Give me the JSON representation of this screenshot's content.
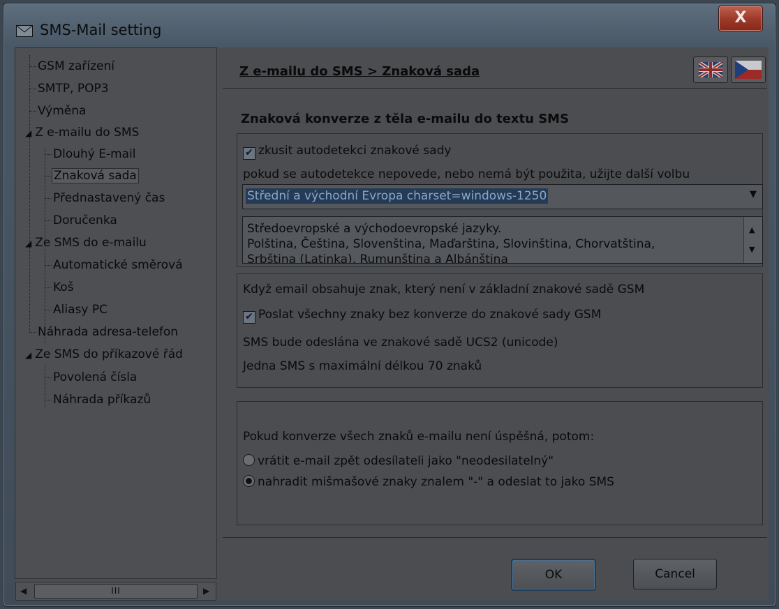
{
  "window": {
    "title": "SMS-Mail setting",
    "close_label": "X"
  },
  "tree": {
    "items": [
      "GSM zařízení",
      "SMTP, POP3",
      "Výměna",
      "Z e-mailu do SMS",
      "Dlouhý E-mail",
      "Znaková sada",
      "Přednastavený čas",
      "Doručenka",
      "Ze SMS do e-mailu",
      "Automatické směrová",
      "Koš",
      "Aliasy PC",
      "Náhrada adresa-telefon",
      "Ze SMS do příkazové řád",
      "Povolená čísla",
      "Náhrada příkazů"
    ],
    "selected": "Znaková sada",
    "scroll_thumb": "III"
  },
  "header": {
    "breadcrumb": "Z e-mailu do SMS  >  Znaková sada"
  },
  "section": {
    "title": "Znaková konverze z těla e-mailu do textu SMS"
  },
  "charset": {
    "autodetect_label": "zkusit autodetekci znakové sady",
    "autodetect_checked": true,
    "fallback_hint": "pokud se autodetekce nepovede, nebo nemá být použita, užijte další volbu",
    "selected_value": "Střední a východní Evropa  charset=windows-1250",
    "description_line1": "Středoevropské a východoevropské jazyky.",
    "description_line2": "Polština, Čeština, Slovenština, Maďarština, Slovinština, Chorvatština,",
    "description_line3": "Srbština (Latinka), Rumunština a Albánština"
  },
  "gsm": {
    "intro": "Když email obsahuje znak, který není v základní znakové sadě GSM",
    "send_all_label": "Poslat všechny znaky bez konverze do znakové sady GSM",
    "send_all_checked": true,
    "ucs2_note": "SMS bude odeslána ve znakové sadě UCS2 (unicode)",
    "length_note": "Jedna SMS s maximální délkou 70 znaků"
  },
  "failure": {
    "intro": "Pokud konverze všech znaků e-mailu není úspěšná, potom:",
    "option_return": "vrátit e-mail zpět odesílateli jako \"neodesilatelný\"",
    "option_replace": "nahradit mišmašové znaky znalem \"-\" a odeslat to jako SMS",
    "selected": "option_replace"
  },
  "buttons": {
    "ok": "OK",
    "cancel": "Cancel"
  }
}
